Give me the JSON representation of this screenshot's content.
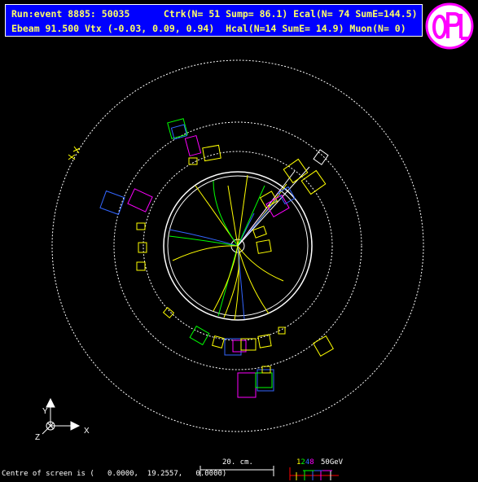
{
  "header": {
    "line1": "Run:event 8885: 50035      Ctrk(N= 51 Sump= 86.1) Ecal(N= 74 SumE=144.5)",
    "line2": "Ebeam 91.500 Vtx (-0.03, 0.09, 0.94)  Hcal(N=14 SumE= 14.9) Muon(N= 0)"
  },
  "axes": {
    "y": "Y",
    "x": "X",
    "z": "Z"
  },
  "footer": {
    "centre_text": "Centre of screen is (   0.0000,  19.2557,   0.0000)",
    "scale_label": "20. cm.",
    "energy_scale": {
      "v1": "1",
      "v2": "2",
      "v4": "4",
      "v8": "8",
      "v50": "50",
      "unit": "GeV"
    }
  },
  "colors": {
    "header_bg": "#0000ff",
    "header_text": "#ffff66",
    "tracks_yellow": "#ffff00",
    "tracks_green": "#00ff00",
    "tracks_blue": "#3366ff",
    "hits_magenta": "#ff00ff",
    "logo": "#ff00ff"
  }
}
